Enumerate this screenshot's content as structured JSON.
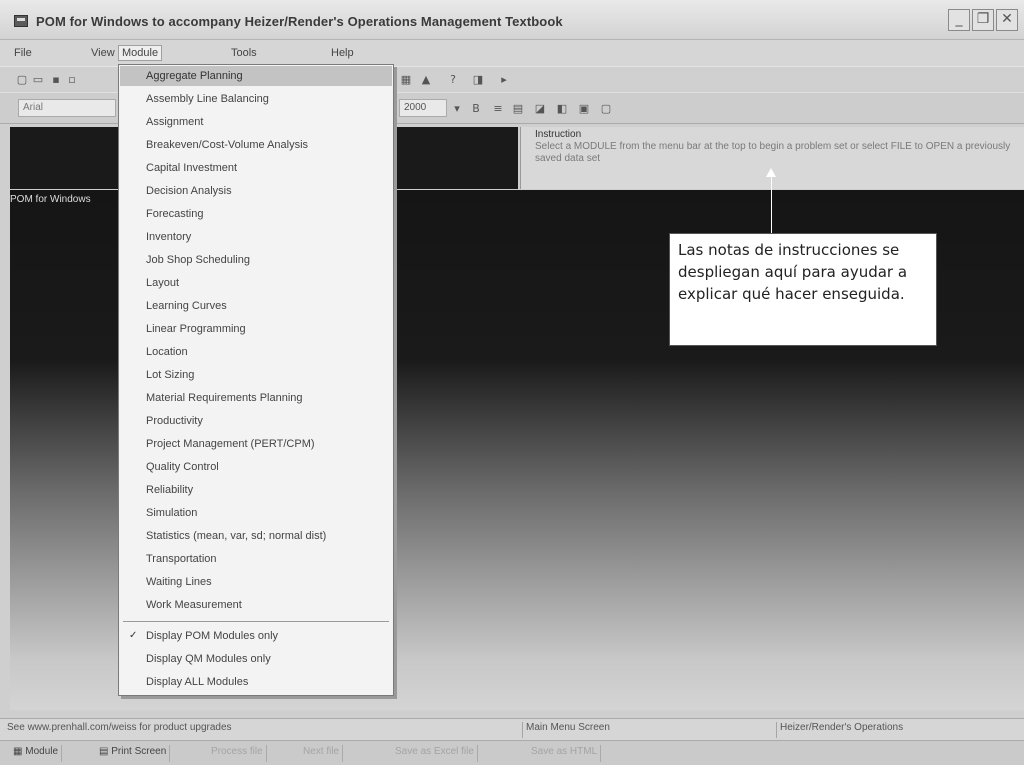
{
  "window": {
    "title": "POM for Windows to accompany Heizer/Render's Operations Management Textbook",
    "minimize_glyph": "_",
    "restore_glyph": "❐",
    "close_glyph": "✕"
  },
  "menubar": {
    "items": [
      {
        "label": "File"
      },
      {
        "label": "View"
      },
      {
        "label": "Module"
      },
      {
        "label": "Tools"
      },
      {
        "label": "Help"
      }
    ]
  },
  "toolbar": {
    "zoom_value": "2000",
    "font_field": "Arial",
    "icons": [
      "new-file-icon",
      "open-folder-icon",
      "save-icon",
      "print-icon",
      "triangle-icon",
      "help-icon",
      "solve-icon"
    ]
  },
  "instruction": {
    "title": "Instruction",
    "text": "Select a MODULE from the menu bar at the top to begin a problem set or select FILE to OPEN a previously saved data set"
  },
  "main": {
    "label": "POM for Windows"
  },
  "callout": {
    "text": "Las notas de instrucciones se despliegan aquí para ayudar a explicar qué hacer enseguida."
  },
  "module_menu": {
    "items": [
      {
        "label": "Aggregate Planning"
      },
      {
        "label": "Assembly Line Balancing"
      },
      {
        "label": "Assignment"
      },
      {
        "label": "Breakeven/Cost-Volume Analysis"
      },
      {
        "label": "Capital Investment"
      },
      {
        "label": "Decision Analysis"
      },
      {
        "label": "Forecasting"
      },
      {
        "label": "Inventory"
      },
      {
        "label": "Job Shop Scheduling"
      },
      {
        "label": "Layout"
      },
      {
        "label": "Learning Curves"
      },
      {
        "label": "Linear Programming"
      },
      {
        "label": "Location"
      },
      {
        "label": "Lot Sizing"
      },
      {
        "label": "Material Requirements Planning"
      },
      {
        "label": "Productivity"
      },
      {
        "label": "Project Management (PERT/CPM)"
      },
      {
        "label": "Quality Control"
      },
      {
        "label": "Reliability"
      },
      {
        "label": "Simulation"
      },
      {
        "label": "Statistics (mean, var, sd; normal dist)"
      },
      {
        "label": "Transportation"
      },
      {
        "label": "Waiting Lines"
      },
      {
        "label": "Work Measurement"
      }
    ],
    "display_options": [
      {
        "label": "Display POM Modules only",
        "checked": true
      },
      {
        "label": "Display QM Modules only",
        "checked": false
      },
      {
        "label": "Display ALL Modules",
        "checked": false
      }
    ],
    "check_glyph": "✓"
  },
  "statusbar": {
    "upgrade_note": "See www.prenhall.com/weiss for product upgrades",
    "screen": "Main Menu Screen",
    "book": "Heizer/Render's Operations"
  },
  "bottombar": {
    "buttons": [
      {
        "label": "Module"
      },
      {
        "label": "Print Screen"
      },
      {
        "label": "Process file"
      },
      {
        "label": "Next file"
      },
      {
        "label": "Save as Excel file"
      },
      {
        "label": "Save as HTML"
      }
    ]
  }
}
